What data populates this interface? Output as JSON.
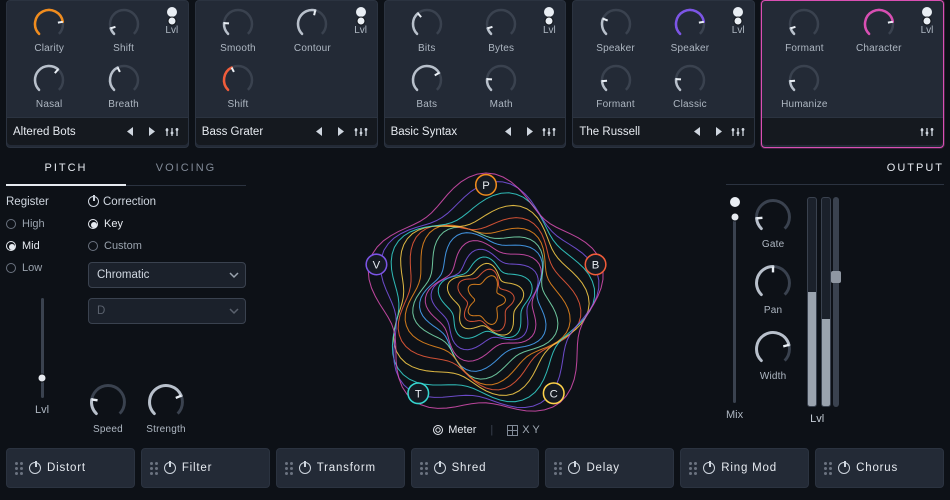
{
  "modules": [
    {
      "preset": "Altered Bots",
      "accent": "#f08c1e",
      "knobs_row1": [
        {
          "label": "Clarity",
          "value": 0.8
        },
        {
          "label": "Shift",
          "value": 0.1,
          "grey": true
        }
      ],
      "knobs_row2": [
        {
          "label": "Nasal",
          "value": 0.65,
          "grey": true
        },
        {
          "label": "Breath",
          "value": 0.4,
          "grey": true
        }
      ],
      "lvl": {
        "value": 0.98,
        "label": "Lvl"
      }
    },
    {
      "preset": "Bass Grater",
      "accent": "#f05c3a",
      "knobs_row1": [
        {
          "label": "Smooth",
          "value": 0.18,
          "grey": true
        },
        {
          "label": "Contour",
          "value": 0.55,
          "grey": true
        }
      ],
      "knobs_row2": [
        {
          "label": "Shift",
          "value": 0.4
        }
      ],
      "lvl": {
        "value": 0.98,
        "label": "Lvl"
      }
    },
    {
      "preset": "Basic Syntax",
      "accent": "#36d6d0",
      "knobs_row1": [
        {
          "label": "Bits",
          "value": 0.35,
          "grey": true
        },
        {
          "label": "Bytes",
          "value": 0.1,
          "grey": true
        }
      ],
      "knobs_row2": [
        {
          "label": "Bats",
          "value": 0.72,
          "grey": true
        },
        {
          "label": "Math",
          "value": 0.18,
          "grey": true
        }
      ],
      "lvl": {
        "value": 0.98,
        "label": "Lvl"
      }
    },
    {
      "preset": "The Russell",
      "accent": "#7c55e6",
      "knobs_row1": [
        {
          "label": "Speaker",
          "value": 0.25,
          "grey": true
        },
        {
          "label": "Speaker",
          "value": 0.8
        }
      ],
      "knobs_row2": [
        {
          "label": "Formant",
          "value": 0.15,
          "grey": true
        },
        {
          "label": "Classic",
          "value": 0.18,
          "grey": true
        }
      ],
      "lvl": {
        "value": 0.98,
        "label": "Lvl"
      }
    },
    {
      "preset": "",
      "accent": "#d94fb3",
      "selected": true,
      "knobs_row1": [
        {
          "label": "Formant",
          "value": 0.1,
          "grey": true
        },
        {
          "label": "Character",
          "value": 0.8
        }
      ],
      "knobs_row2": [
        {
          "label": "Humanize",
          "value": 0.15,
          "grey": true
        }
      ],
      "lvl": {
        "value": 0.98,
        "label": "Lvl"
      }
    }
  ],
  "pitch_panel": {
    "tabs": {
      "pitch": "PITCH",
      "voicing": "VOICING",
      "active": "pitch"
    },
    "register": {
      "title": "Register",
      "options": [
        "High",
        "Mid",
        "Low"
      ],
      "selected": "Mid",
      "lvl_label": "Lvl",
      "lvl_value": 0.2
    },
    "correction": {
      "title": "Correction",
      "mode_options": [
        "Key",
        "Custom"
      ],
      "mode_selected": "Key",
      "scale_value": "Chromatic",
      "root_value": "D",
      "root_disabled": true,
      "speed_label": "Speed",
      "speed_value": 0.2,
      "strength_label": "Strength",
      "strength_value": 0.75
    }
  },
  "viz": {
    "nodes": [
      "P",
      "B",
      "C",
      "T",
      "V"
    ],
    "mode_labels": {
      "meter": "Meter",
      "xy": "X Y"
    },
    "mode": "meter"
  },
  "output": {
    "title": "OUTPUT",
    "mix": {
      "label": "Mix",
      "value": 0.98
    },
    "gate": {
      "label": "Gate",
      "value": 0.15
    },
    "pan": {
      "label": "Pan",
      "value": 0.5
    },
    "width": {
      "label": "Width",
      "value": 0.78
    },
    "lvl_label": "Lvl",
    "meters": {
      "l": 0.55,
      "r": 0.42,
      "handle": 0.35
    }
  },
  "fx": [
    {
      "name": "Distort"
    },
    {
      "name": "Filter"
    },
    {
      "name": "Transform"
    },
    {
      "name": "Shred"
    },
    {
      "name": "Delay"
    },
    {
      "name": "Ring Mod"
    },
    {
      "name": "Chorus"
    }
  ]
}
